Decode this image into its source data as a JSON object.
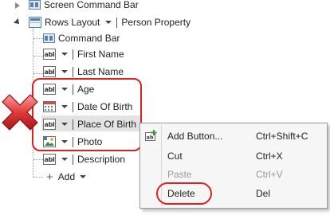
{
  "tree": {
    "screen_command_bar": "Screen Command Bar",
    "rows_layout": "Rows Layout",
    "rows_layout_binding": "Person Property",
    "command_bar": "Command Bar",
    "items": [
      {
        "label": "First Name",
        "icon": "textbox-abl-icon"
      },
      {
        "label": "Last Name",
        "icon": "textbox-abl-icon"
      },
      {
        "label": "Age",
        "icon": "textbox-abl-icon"
      },
      {
        "label": "Date Of Birth",
        "icon": "date-picker-icon"
      },
      {
        "label": "Place Of Birth",
        "icon": "textbox-abl-icon"
      },
      {
        "label": "Photo",
        "icon": "image-editor-icon"
      },
      {
        "label": "Description",
        "icon": "textbox-abl-icon"
      }
    ],
    "add_label": "Add",
    "add_symbol": "+"
  },
  "context_menu": {
    "items": [
      {
        "label": "Add Button...",
        "shortcut": "Ctrl+Shift+C",
        "enabled": true,
        "icon": "add-button-icon"
      },
      {
        "label": "Cut",
        "shortcut": "Ctrl+X",
        "enabled": true
      },
      {
        "label": "Paste",
        "shortcut": "Ctrl+V",
        "enabled": false
      },
      {
        "label": "Delete",
        "shortcut": "Del",
        "enabled": true
      }
    ]
  },
  "colors": {
    "highlight_circle": "#e02020",
    "delete_x": "#d8383a",
    "selected_row": "#e3e3e3"
  }
}
